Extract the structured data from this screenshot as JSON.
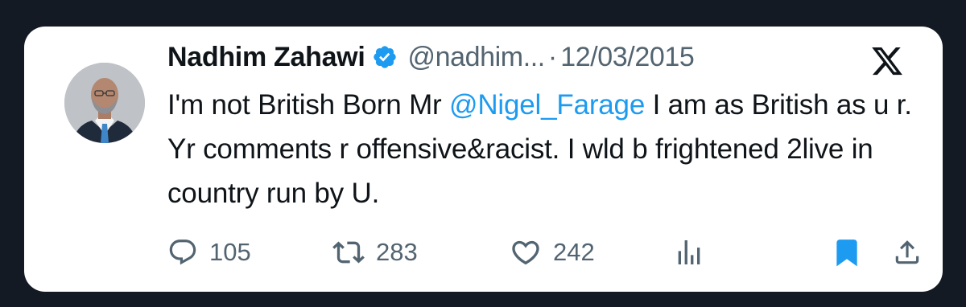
{
  "tweet": {
    "author_name": "Nadhim Zahawi",
    "handle": "@nadhim...",
    "separator": "·",
    "date": "12/03/2015",
    "text_before": "I'm not British Born Mr ",
    "mention": "@Nigel_Farage",
    "text_after": " I am as British as u r. Yr comments r offensive&racist. I wld b frightened 2live in country run by U."
  },
  "actions": {
    "replies": "105",
    "retweets": "283",
    "likes": "242"
  },
  "icons": {
    "verified": "verified-badge-icon",
    "platform": "x-logo-icon",
    "reply": "reply-icon",
    "retweet": "retweet-icon",
    "like": "heart-icon",
    "views": "views-chart-icon",
    "bookmark": "bookmark-icon",
    "share": "share-icon"
  },
  "colors": {
    "accent": "#1d9bf0",
    "text": "#0f1419",
    "muted": "#536471",
    "background": "#141a24",
    "card": "#ffffff"
  }
}
